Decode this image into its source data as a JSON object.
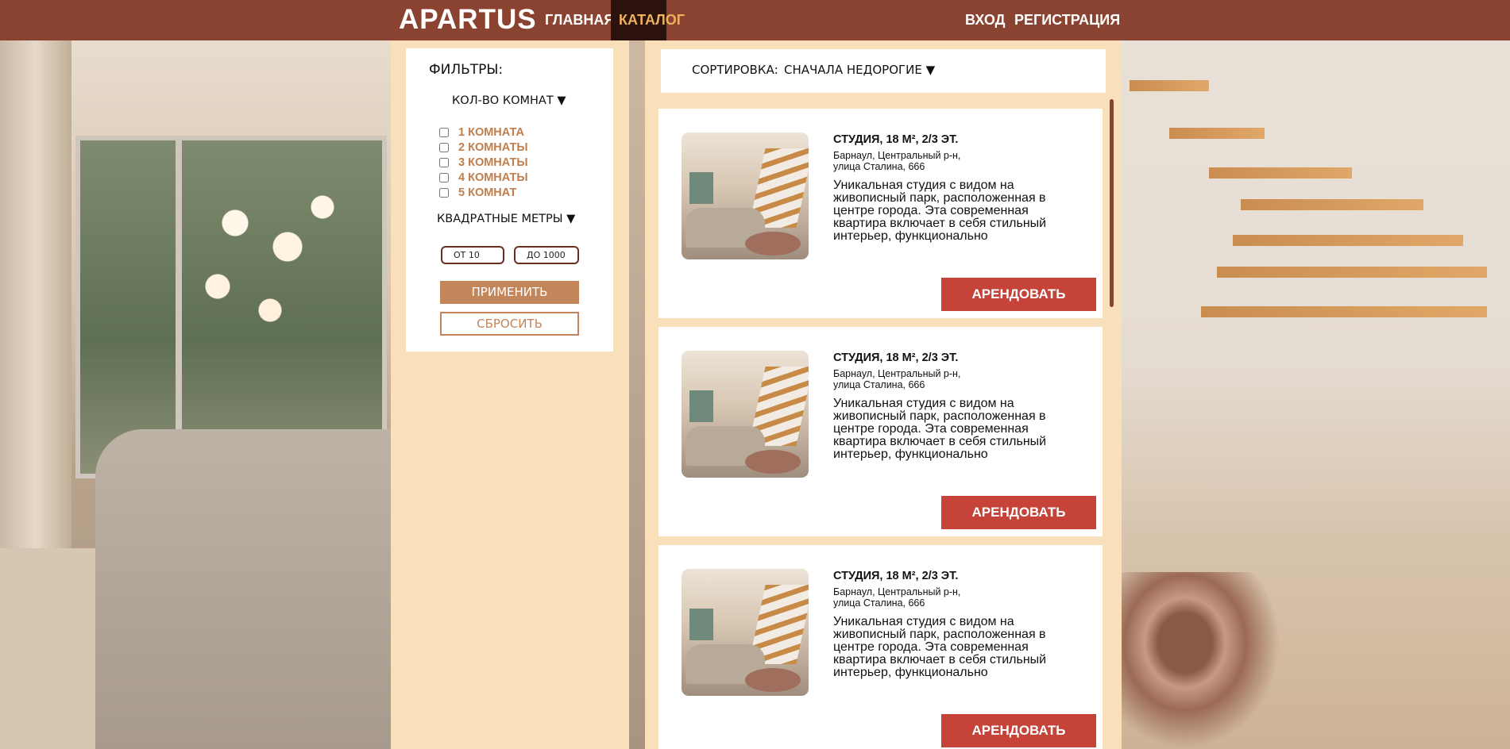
{
  "nav": {
    "logo": "APARTUS",
    "links": [
      {
        "label": "ГЛАВНАЯ"
      },
      {
        "label": "КАТАЛОГ"
      }
    ],
    "login": "ВХОД",
    "register": "РЕГИСТРАЦИЯ"
  },
  "filters": {
    "title": "ФИЛЬТРЫ:",
    "rooms_title": "КОЛ-ВО КОМНАТ ▼",
    "rooms": [
      "1 КОМНАТА",
      "2 КОМНАТЫ",
      "3 КОМНАТЫ",
      "4 КОМНАТЫ",
      "5 КОМНАТ"
    ],
    "area_title": "КВАДРАТНЫЕ МЕТРЫ ▼",
    "from_placeholder": "ОТ 10",
    "to_placeholder": "ДО 1000",
    "apply": "ПРИМЕНИТЬ",
    "reset": "СБРОСИТЬ"
  },
  "sort": {
    "label": "СОРТИРОВКА:",
    "value": "СНАЧАЛА НЕДОРОГИЕ ▼"
  },
  "listings": [
    {
      "title": "СТУДИЯ, 18 М², 2/3 ЭТ.",
      "address": "Барнаул, Центральный р-н, улица Сталина, 666",
      "description": "Уникальная студия с видом на живописный парк, расположенная в центре города. Эта современная квартира включает в себя стильный интерьер, функционально оборудованную кухню и просторную...",
      "button": "АРЕНДОВАТЬ"
    },
    {
      "title": "СТУДИЯ, 18 М², 2/3 ЭТ.",
      "address": "Барнаул, Центральный р-н, улица Сталина, 666",
      "description": "Уникальная студия с видом на живописный парк, расположенная в центре города. Эта современная квартира включает в себя стильный интерьер, функционально оборудованную кухню и просторную...",
      "button": "АРЕНДОВАТЬ"
    },
    {
      "title": "СТУДИЯ, 18 М², 2/3 ЭТ.",
      "address": "Барнаул, Центральный р-н, улица Сталина, 666",
      "description": "Уникальная студия с видом на живописный парк, расположенная в центре города. Эта современная квартира включает в себя стильный интерьер, функционально оборудованную кухню и просторную...",
      "button": "АРЕНДОВАТЬ"
    }
  ],
  "colors": {
    "header": "#8b4331",
    "active_nav_bg": "#2b120c",
    "active_nav_text": "#f0b15d",
    "panel_bg": "#f9e0bb",
    "accent": "#c3855a",
    "rent_button": "#c6433a"
  }
}
